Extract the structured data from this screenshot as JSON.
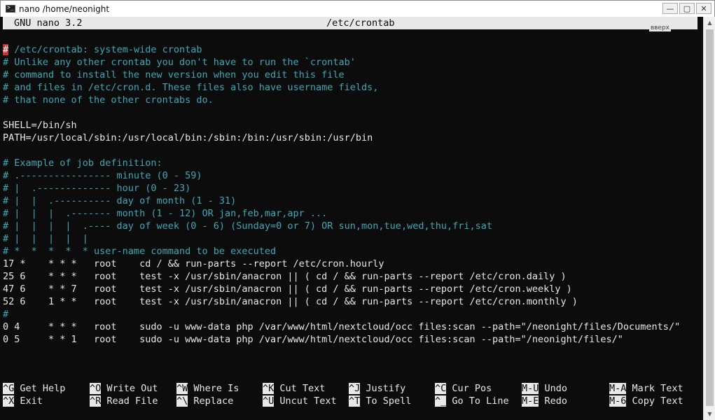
{
  "window": {
    "title": "nano /home/neonight",
    "minimize_glyph": "—",
    "maximize_glyph": "▢",
    "close_glyph": "✕",
    "icon": "terminal-icon"
  },
  "nano": {
    "version": "GNU nano 3.2",
    "filename": "/etc/crontab",
    "scroll_hint": "вверх"
  },
  "editor": {
    "lines": [
      {
        "text": " /etc/crontab: system-wide crontab",
        "type": "comment",
        "cursor": "#"
      },
      {
        "text": "# Unlike any other crontab you don't have to run the `crontab'",
        "type": "comment"
      },
      {
        "text": "# command to install the new version when you edit this file",
        "type": "comment"
      },
      {
        "text": "# and files in /etc/cron.d. These files also have username fields,",
        "type": "comment"
      },
      {
        "text": "# that none of the other crontabs do.",
        "type": "comment"
      },
      {
        "text": "",
        "type": "plain"
      },
      {
        "text": "SHELL=/bin/sh",
        "type": "plain"
      },
      {
        "text": "PATH=/usr/local/sbin:/usr/local/bin:/sbin:/bin:/usr/sbin:/usr/bin",
        "type": "plain"
      },
      {
        "text": "",
        "type": "plain"
      },
      {
        "text": "# Example of job definition:",
        "type": "comment"
      },
      {
        "text": "# .---------------- minute (0 - 59)",
        "type": "comment"
      },
      {
        "text": "# |  .------------- hour (0 - 23)",
        "type": "comment"
      },
      {
        "text": "# |  |  .---------- day of month (1 - 31)",
        "type": "comment"
      },
      {
        "text": "# |  |  |  .------- month (1 - 12) OR jan,feb,mar,apr ...",
        "type": "comment"
      },
      {
        "text": "# |  |  |  |  .---- day of week (0 - 6) (Sunday=0 or 7) OR sun,mon,tue,wed,thu,fri,sat",
        "type": "comment"
      },
      {
        "text": "# |  |  |  |  |",
        "type": "comment"
      },
      {
        "text": "# *  *  *  *  * user-name command to be executed",
        "type": "comment"
      },
      {
        "text": "17 *    * * *   root    cd / && run-parts --report /etc/cron.hourly",
        "type": "plain"
      },
      {
        "text": "25 6    * * *   root    test -x /usr/sbin/anacron || ( cd / && run-parts --report /etc/cron.daily )",
        "type": "plain"
      },
      {
        "text": "47 6    * * 7   root    test -x /usr/sbin/anacron || ( cd / && run-parts --report /etc/cron.weekly )",
        "type": "plain"
      },
      {
        "text": "52 6    1 * *   root    test -x /usr/sbin/anacron || ( cd / && run-parts --report /etc/cron.monthly )",
        "type": "plain"
      },
      {
        "text": "#",
        "type": "comment"
      },
      {
        "text": "0 4     * * *   root    sudo -u www-data php /var/www/html/nextcloud/occ files:scan --path=\"/neonight/files/Documents/\"",
        "type": "plain"
      },
      {
        "text": "0 5     * * 1   root    sudo -u www-data php /var/www/html/nextcloud/occ files:scan --path=\"/neonight/files/\"",
        "type": "plain"
      }
    ]
  },
  "shortcuts": {
    "row1": [
      {
        "key": "^G",
        "label": " Get Help"
      },
      {
        "key": "^O",
        "label": " Write Out"
      },
      {
        "key": "^W",
        "label": " Where Is"
      },
      {
        "key": "^K",
        "label": " Cut Text"
      },
      {
        "key": "^J",
        "label": " Justify"
      },
      {
        "key": "^C",
        "label": " Cur Pos"
      },
      {
        "key": "M-U",
        "label": " Undo"
      },
      {
        "key": "M-A",
        "label": " Mark Text"
      }
    ],
    "row2": [
      {
        "key": "^X",
        "label": " Exit"
      },
      {
        "key": "^R",
        "label": " Read File"
      },
      {
        "key": "^\\",
        "label": " Replace"
      },
      {
        "key": "^U",
        "label": " Uncut Text"
      },
      {
        "key": "^T",
        "label": " To Spell"
      },
      {
        "key": "^_",
        "label": " Go To Line"
      },
      {
        "key": "M-E",
        "label": " Redo"
      },
      {
        "key": "M-6",
        "label": " Copy Text"
      }
    ]
  },
  "colors": {
    "terminal_bg": "#0c0c0c",
    "comment": "#3fa7b5",
    "text": "#e8e8e8",
    "cursor": "#c9302c"
  }
}
